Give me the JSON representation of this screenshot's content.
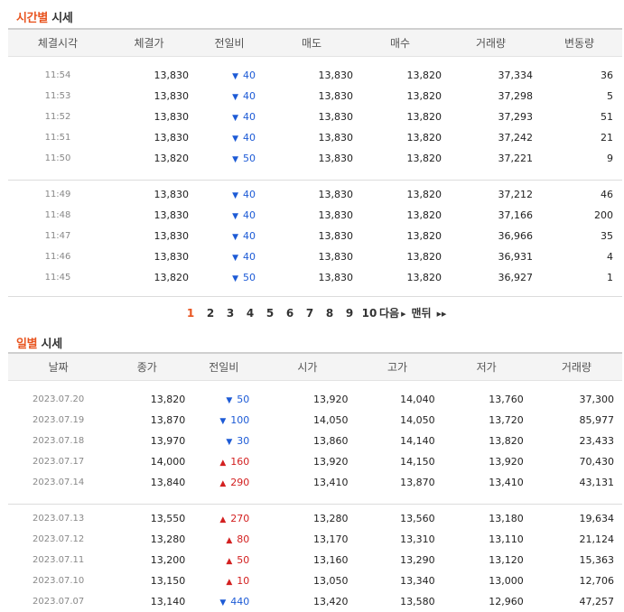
{
  "time_section": {
    "title_accent": "시간별",
    "title_rest": " 시세",
    "headers": [
      "체결시각",
      "체결가",
      "전일비",
      "매도",
      "매수",
      "거래량",
      "변동량"
    ],
    "groups": [
      [
        {
          "time": "11:54",
          "price": "13,830",
          "dir": "down",
          "change": "40",
          "ask": "13,830",
          "bid": "13,820",
          "volume": "37,334",
          "delta": "36"
        },
        {
          "time": "11:53",
          "price": "13,830",
          "dir": "down",
          "change": "40",
          "ask": "13,830",
          "bid": "13,820",
          "volume": "37,298",
          "delta": "5"
        },
        {
          "time": "11:52",
          "price": "13,830",
          "dir": "down",
          "change": "40",
          "ask": "13,830",
          "bid": "13,820",
          "volume": "37,293",
          "delta": "51"
        },
        {
          "time": "11:51",
          "price": "13,830",
          "dir": "down",
          "change": "40",
          "ask": "13,830",
          "bid": "13,820",
          "volume": "37,242",
          "delta": "21"
        },
        {
          "time": "11:50",
          "price": "13,820",
          "dir": "down",
          "change": "50",
          "ask": "13,830",
          "bid": "13,820",
          "volume": "37,221",
          "delta": "9"
        }
      ],
      [
        {
          "time": "11:49",
          "price": "13,830",
          "dir": "down",
          "change": "40",
          "ask": "13,830",
          "bid": "13,820",
          "volume": "37,212",
          "delta": "46"
        },
        {
          "time": "11:48",
          "price": "13,830",
          "dir": "down",
          "change": "40",
          "ask": "13,830",
          "bid": "13,820",
          "volume": "37,166",
          "delta": "200"
        },
        {
          "time": "11:47",
          "price": "13,830",
          "dir": "down",
          "change": "40",
          "ask": "13,830",
          "bid": "13,820",
          "volume": "36,966",
          "delta": "35"
        },
        {
          "time": "11:46",
          "price": "13,830",
          "dir": "down",
          "change": "40",
          "ask": "13,830",
          "bid": "13,820",
          "volume": "36,931",
          "delta": "4"
        },
        {
          "time": "11:45",
          "price": "13,820",
          "dir": "down",
          "change": "50",
          "ask": "13,830",
          "bid": "13,820",
          "volume": "36,927",
          "delta": "1"
        }
      ]
    ]
  },
  "pagination": {
    "pages": [
      "1",
      "2",
      "3",
      "4",
      "5",
      "6",
      "7",
      "8",
      "9",
      "10"
    ],
    "current": "1",
    "next_label": "다음",
    "last_label": "맨뒤"
  },
  "daily_section": {
    "title_accent": "일별",
    "title_rest": " 시세",
    "headers": [
      "날짜",
      "종가",
      "전일비",
      "시가",
      "고가",
      "저가",
      "거래량"
    ],
    "groups": [
      [
        {
          "date": "2023.07.20",
          "close": "13,820",
          "dir": "down",
          "change": "50",
          "open": "13,920",
          "high": "14,040",
          "low": "13,760",
          "volume": "37,300"
        },
        {
          "date": "2023.07.19",
          "close": "13,870",
          "dir": "down",
          "change": "100",
          "open": "14,050",
          "high": "14,050",
          "low": "13,720",
          "volume": "85,977"
        },
        {
          "date": "2023.07.18",
          "close": "13,970",
          "dir": "down",
          "change": "30",
          "open": "13,860",
          "high": "14,140",
          "low": "13,820",
          "volume": "23,433"
        },
        {
          "date": "2023.07.17",
          "close": "14,000",
          "dir": "up",
          "change": "160",
          "open": "13,920",
          "high": "14,150",
          "low": "13,920",
          "volume": "70,430"
        },
        {
          "date": "2023.07.14",
          "close": "13,840",
          "dir": "up",
          "change": "290",
          "open": "13,410",
          "high": "13,870",
          "low": "13,410",
          "volume": "43,131"
        }
      ],
      [
        {
          "date": "2023.07.13",
          "close": "13,550",
          "dir": "up",
          "change": "270",
          "open": "13,280",
          "high": "13,560",
          "low": "13,180",
          "volume": "19,634"
        },
        {
          "date": "2023.07.12",
          "close": "13,280",
          "dir": "up",
          "change": "80",
          "open": "13,170",
          "high": "13,310",
          "low": "13,110",
          "volume": "21,124"
        },
        {
          "date": "2023.07.11",
          "close": "13,200",
          "dir": "up",
          "change": "50",
          "open": "13,160",
          "high": "13,290",
          "low": "13,120",
          "volume": "15,363"
        },
        {
          "date": "2023.07.10",
          "close": "13,150",
          "dir": "up",
          "change": "10",
          "open": "13,050",
          "high": "13,340",
          "low": "13,000",
          "volume": "12,706"
        },
        {
          "date": "2023.07.07",
          "close": "13,140",
          "dir": "down",
          "change": "440",
          "open": "13,420",
          "high": "13,580",
          "low": "12,960",
          "volume": "47,257"
        }
      ]
    ]
  },
  "colors": {
    "accent": "#e8541f",
    "down": "#1d5bd6",
    "up": "#d32020"
  },
  "icons": {
    "down": "▼",
    "up": "▲",
    "next": "triangle-right-icon",
    "last": "double-triangle-right-icon"
  }
}
